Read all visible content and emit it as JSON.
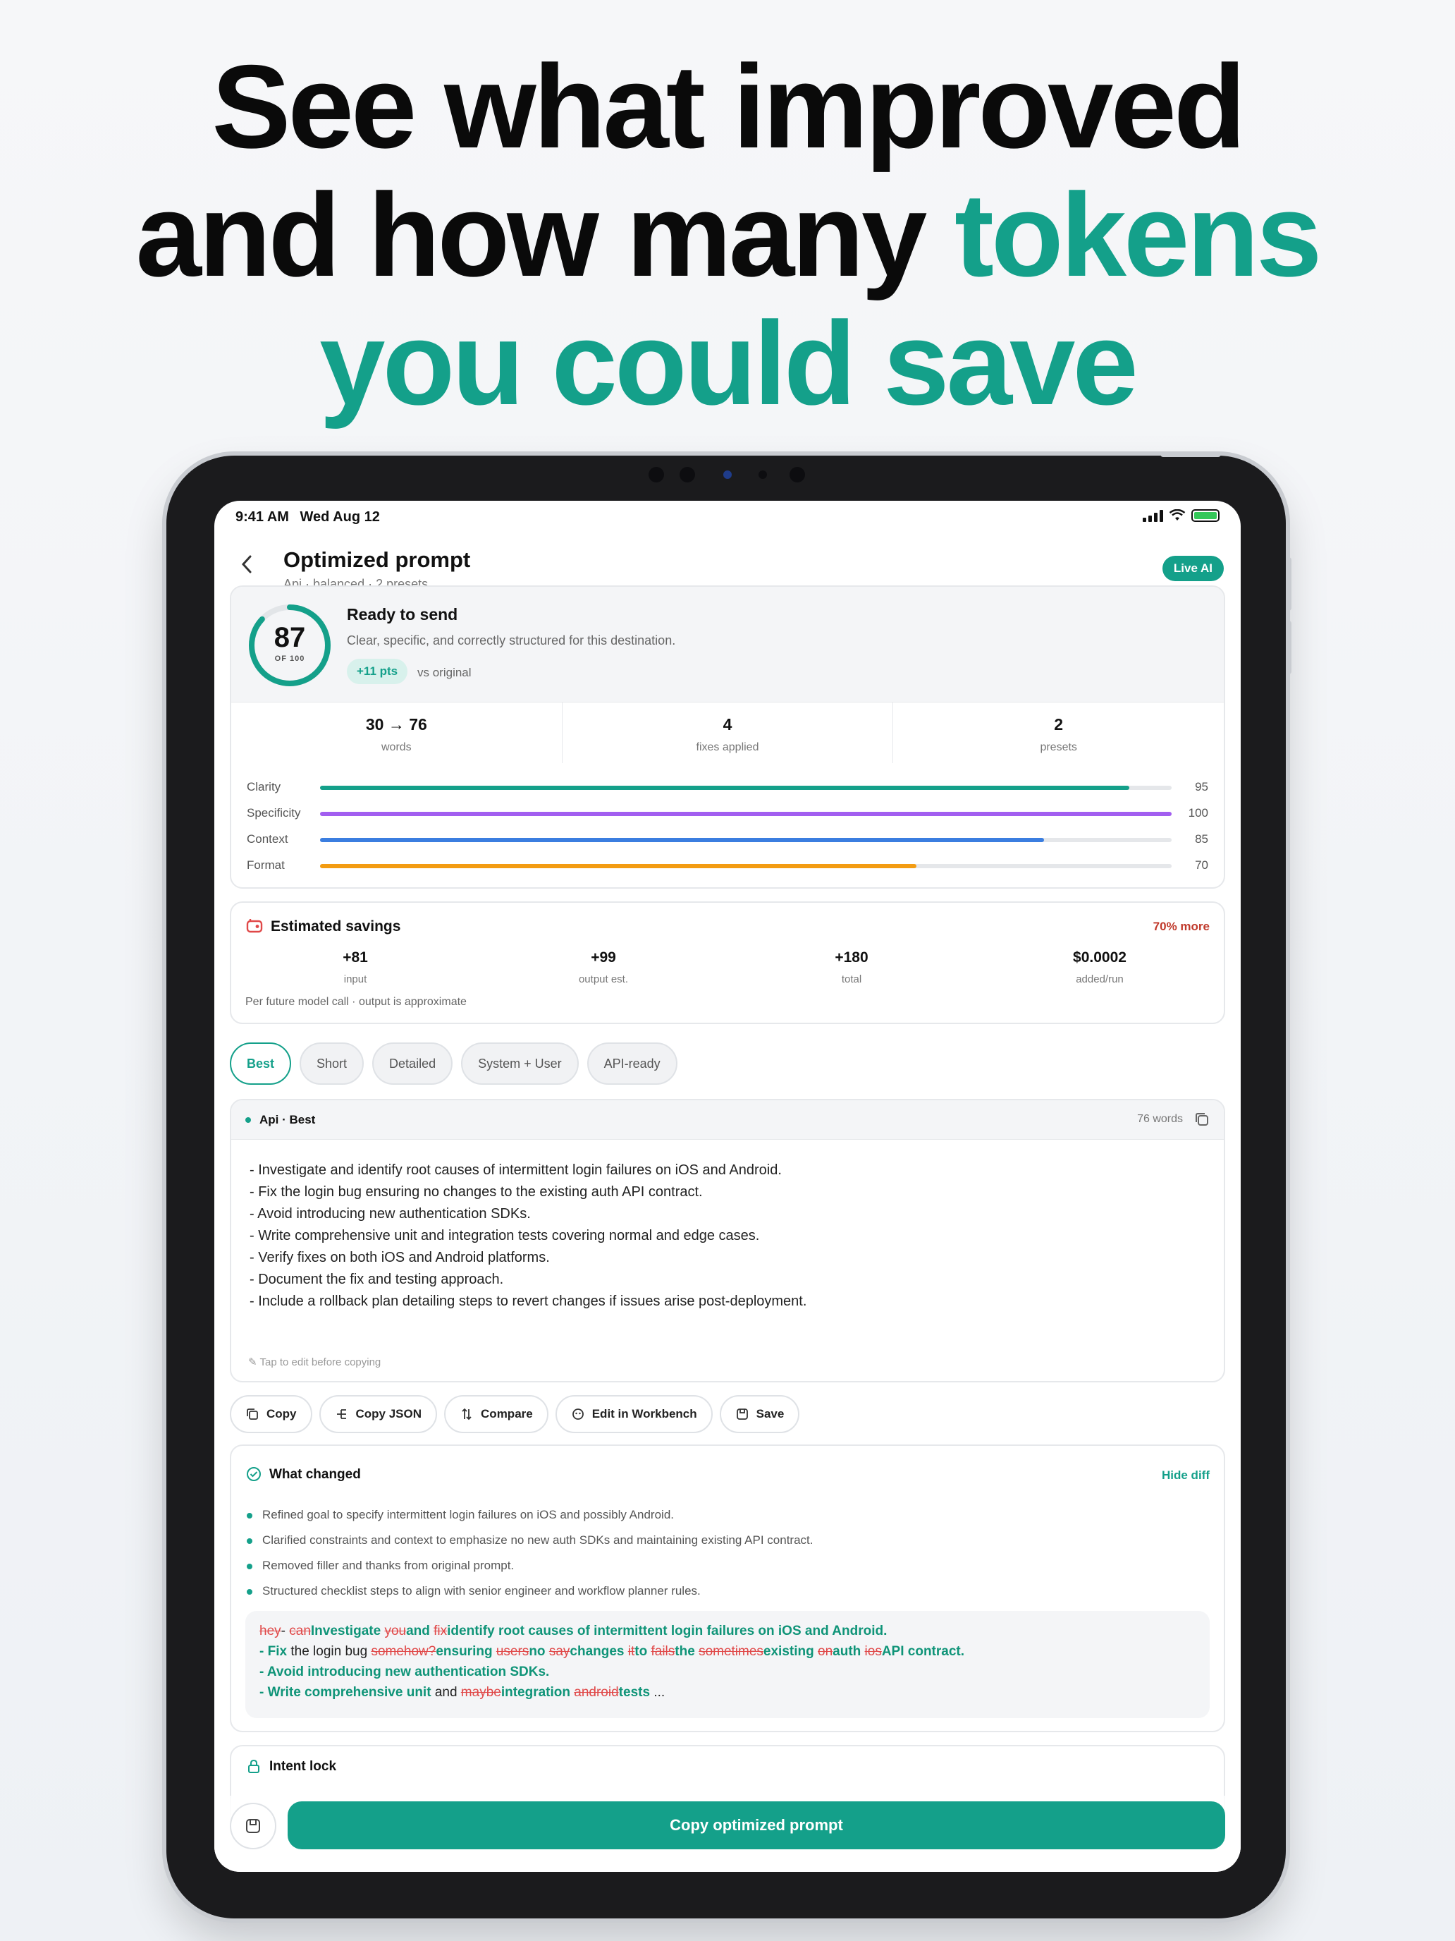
{
  "headline": {
    "line1": "See what improved",
    "line2_prefix": "and how many ",
    "line2_accent": "tokens",
    "line3": "you could save"
  },
  "status_bar": {
    "time": "9:41 AM",
    "date": "Wed Aug 12"
  },
  "nav": {
    "title": "Optimized prompt",
    "subtitle": "Api · balanced · 2 presets",
    "badge": "Live AI"
  },
  "score": {
    "value": "87",
    "of_label": "OF 100",
    "fraction": 0.87,
    "status": "Ready to send",
    "description": "Clear, specific, and correctly structured for this destination.",
    "delta": "+11 pts",
    "delta_suffix": "vs original"
  },
  "stats": [
    {
      "value": "30 → 76",
      "label": "words"
    },
    {
      "value": "4",
      "label": "fixes applied"
    },
    {
      "value": "2",
      "label": "presets"
    }
  ],
  "metrics": [
    {
      "label": "Clarity",
      "value": "95",
      "fraction": 0.95,
      "color": "#14a08a"
    },
    {
      "label": "Specificity",
      "value": "100",
      "fraction": 1.0,
      "color": "#a25ef0"
    },
    {
      "label": "Context",
      "value": "85",
      "fraction": 0.85,
      "color": "#3b7ee0"
    },
    {
      "label": "Format",
      "value": "70",
      "fraction": 0.7,
      "color": "#f39c12"
    }
  ],
  "savings": {
    "title": "Estimated savings",
    "more": "70% more",
    "items": [
      {
        "value": "+81",
        "label": "input"
      },
      {
        "value": "+99",
        "label": "output est."
      },
      {
        "value": "+180",
        "label": "total"
      },
      {
        "value": "$0.0002",
        "label": "added/run"
      }
    ],
    "note": "Per future model call · output is approximate"
  },
  "chips": [
    "Best",
    "Short",
    "Detailed",
    "System + User",
    "API-ready"
  ],
  "prompt": {
    "label": "Api · Best",
    "word_count": "76 words",
    "lines": [
      "- Investigate and identify root causes of intermittent login failures on iOS and Android.",
      "- Fix the login bug ensuring no changes to the existing auth API contract.",
      "- Avoid introducing new authentication SDKs.",
      "- Write comprehensive unit and integration tests covering normal and edge cases.",
      "- Verify fixes on both iOS and Android platforms.",
      "- Document the fix and testing approach.",
      "- Include a rollback plan detailing steps to revert changes if issues arise post-deployment."
    ],
    "hint": "Tap to edit before copying"
  },
  "actions": [
    "Copy",
    "Copy JSON",
    "Compare",
    "Edit in Workbench",
    "Save"
  ],
  "what_changed": {
    "title": "What changed",
    "toggle": "Hide diff",
    "items": [
      "Refined goal to specify intermittent login failures on iOS and possibly Android.",
      "Clarified constraints and context to emphasize no new auth SDKs and maintaining existing API contract.",
      "Removed filler and thanks from original prompt.",
      "Structured checklist steps to align with senior engineer and workflow planner rules."
    ]
  },
  "diff": {
    "line1": [
      {
        "t": "hey",
        "k": "del"
      },
      {
        "t": "- ",
        "k": "keep"
      },
      {
        "t": "can",
        "k": "del"
      },
      {
        "t": "Investigate ",
        "k": "add"
      },
      {
        "t": "you",
        "k": "del"
      },
      {
        "t": "and ",
        "k": "add"
      },
      {
        "t": "fix",
        "k": "del"
      },
      {
        "t": "identify root causes of intermittent login failures on iOS and Android.",
        "k": "add"
      }
    ],
    "line2": [
      {
        "t": "- Fix ",
        "k": "add"
      },
      {
        "t": "the login bug ",
        "k": "keep"
      },
      {
        "t": "somehow?",
        "k": "del"
      },
      {
        "t": "ensuring ",
        "k": "add"
      },
      {
        "t": "users",
        "k": "del"
      },
      {
        "t": "no ",
        "k": "add"
      },
      {
        "t": "say",
        "k": "del"
      },
      {
        "t": "changes ",
        "k": "add"
      },
      {
        "t": "it",
        "k": "del"
      },
      {
        "t": "to ",
        "k": "add"
      },
      {
        "t": "fails",
        "k": "del"
      },
      {
        "t": "the ",
        "k": "add"
      },
      {
        "t": "sometimes",
        "k": "del"
      },
      {
        "t": "existing ",
        "k": "add"
      },
      {
        "t": "on",
        "k": "del"
      },
      {
        "t": "auth ",
        "k": "add"
      },
      {
        "t": "ios",
        "k": "del"
      },
      {
        "t": "API contract.",
        "k": "add"
      }
    ],
    "line3": [
      {
        "t": "- Avoid introducing new authentication SDKs.",
        "k": "add"
      }
    ],
    "line4": [
      {
        "t": "- Write comprehensive unit ",
        "k": "add"
      },
      {
        "t": "and ",
        "k": "keep"
      },
      {
        "t": "maybe",
        "k": "del"
      },
      {
        "t": "integration ",
        "k": "add"
      },
      {
        "t": "android",
        "k": "del"
      },
      {
        "t": "tests ",
        "k": "add"
      },
      {
        "t": "...",
        "k": "keep"
      }
    ]
  },
  "intent": {
    "title": "Intent lock"
  },
  "primary_button": "Copy optimized prompt",
  "colors": {
    "accent": "#14a08a",
    "danger": "#e04848"
  }
}
